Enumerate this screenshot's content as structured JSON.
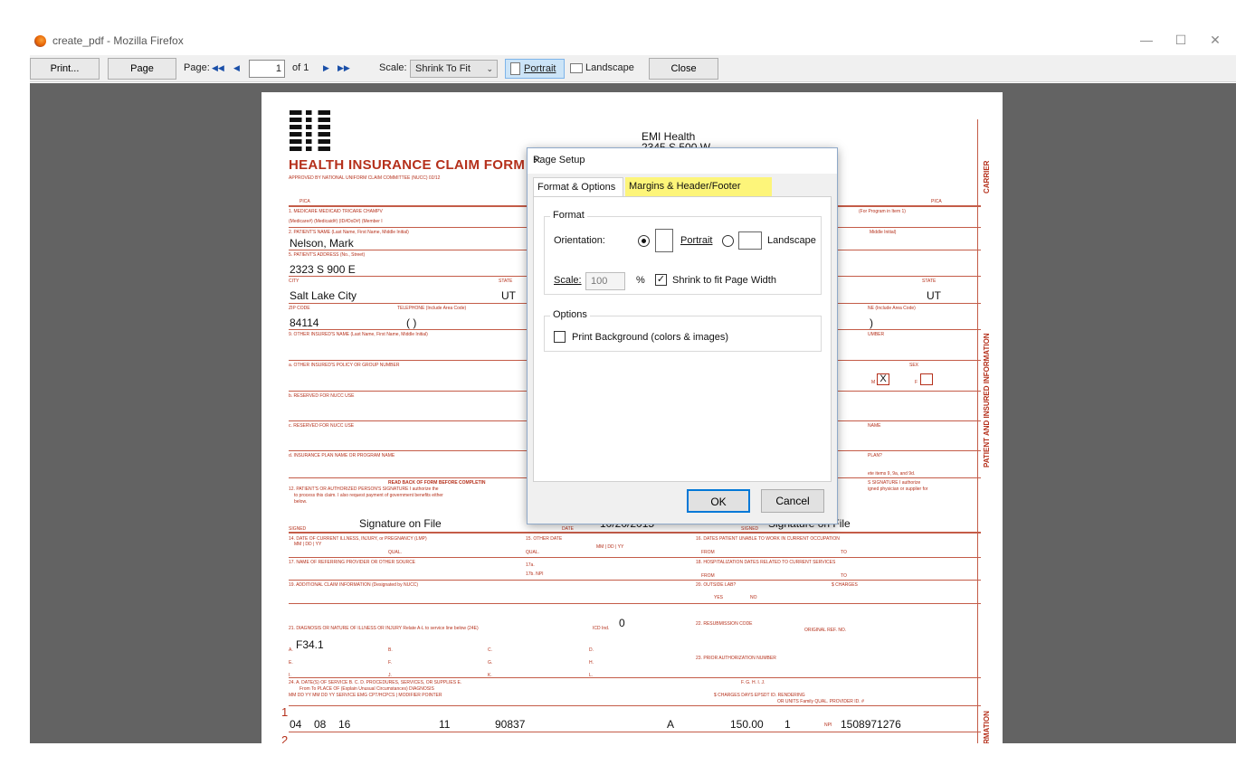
{
  "window": {
    "title": "create_pdf - Mozilla Firefox",
    "minimize": "—",
    "maximize": "☐",
    "close": "✕"
  },
  "toolbar": {
    "print": "Print...",
    "page_setup": "Page Setup...",
    "page_label": "Page:",
    "first_icon": "◀◀",
    "prev_icon": "◀",
    "page_value": "1",
    "of_text": "of  1",
    "next_icon": "▶",
    "last_icon": "▶▶",
    "scale_label": "Scale:",
    "scale_value": "Shrink To Fit",
    "portrait": "Portrait",
    "landscape": "Landscape",
    "close": "Close"
  },
  "form": {
    "payer_name": "EMI Health",
    "payer_addr": "2345 S 500 W",
    "title": "HEALTH INSURANCE CLAIM FORM",
    "subtitle": "APPROVED BY NATIONAL UNIFORM CLAIM COMMITTEE (NUCC) 02/12",
    "pica_left": "PICA",
    "pica_right": "PICA",
    "medicare_row": "1.  MEDICARE      MEDICAID        TRICARE           CHAMPV",
    "medicare_row2": "(Medicare#)       (Medicaid#)       (ID#DoD#)         (Member I",
    "program_note": "(For Program in Item 1)",
    "patient_name_lbl": "2. PATIENT'S NAME (Last Name, First Name, Middle Initial)",
    "patient_name": "Nelson, Mark",
    "middle_initial_lbl": "Middle Initial)",
    "address_lbl": "5. PATIENT'S ADDRESS (No., Street)",
    "address": "2323 S 900 E",
    "city_lbl": "CITY",
    "state_lbl": "STATE",
    "city": "Salt Lake City",
    "state": "UT",
    "state2_lbl": "STATE",
    "state2": "UT",
    "zip_lbl": "ZIP CODE",
    "phone_lbl": "TELEPHONE (Include Area Code)",
    "zip": "84114",
    "phone_paren": "(      )",
    "phone2_lbl": "NE (Include Area Code)",
    "phone2_paren": ")",
    "other_insured_lbl": "9. OTHER INSURED'S NAME (Last Name, First Name, Middle Initial)",
    "number_lbl": "UMBER",
    "other_policy_lbl": "a. OTHER INSURED'S POLICY OR GROUP NUMBER",
    "sex_lbl": "SEX",
    "m_lbl": "M",
    "m_mark": "X",
    "f_lbl": "F",
    "nucc_lbl_b": "b. RESERVED FOR NUCC USE",
    "nucc_lbl_c": "c. RESERVED FOR NUCC USE",
    "name_lbl": "NAME",
    "plan_lbl": "d. INSURANCE PLAN NAME OR PROGRAM NAME",
    "plan_q": "PLAN?",
    "items_note": "ete items 9, 9a, and 9d.",
    "read_back": "READ BACK OF FORM BEFORE COMPLETIN",
    "sig_text": "12. PATIENT'S OR AUTHORIZED PERSON'S SIGNATURE  I authorize the",
    "sig_text2": "to process this claim. I also request payment of government benefits either",
    "sig_text3": "below.",
    "insured_sig_note": "S SIGNATURE I authorize",
    "insured_sig_note2": "igned physician or supplier for",
    "signed_lbl": "SIGNED",
    "signature": "Signature on File",
    "date_lbl": "DATE",
    "date_value": "10/20/2015",
    "signed2_lbl": "SIGNED",
    "signature2": "Signature on File",
    "illness_lbl": "14. DATE OF CURRENT ILLNESS, INJURY, or PREGNANCY (LMP)",
    "mmddyy": "MM  |  DD  |  YY",
    "qual": "QUAL.",
    "other_date_lbl": "15. OTHER DATE",
    "qual2": "QUAL.",
    "mmddyy2": "MM  |  DD  |  YY",
    "unable_lbl": "16. DATES PATIENT UNABLE TO WORK IN CURRENT OCCUPATION",
    "from_lbl": "FROM",
    "to_lbl": "TO",
    "referring_lbl": "17. NAME OF REFERRING PROVIDER OR OTHER SOURCE",
    "ref_17a": "17a.",
    "ref_17b": "17b.  NPI",
    "hosp_lbl": "18. HOSPITALIZATION DATES RELATED TO CURRENT SERVICES",
    "from2_lbl": "FROM",
    "to2_lbl": "TO",
    "addl_lbl": "19. ADDITIONAL CLAIM INFORMATION (Designated by NUCC)",
    "outside_lab_lbl": "20. OUTSIDE LAB?",
    "charges_lbl": "$ CHARGES",
    "yes_lbl": "YES",
    "no_lbl": "NO",
    "diag_lbl": "21. DIAGNOSIS OR NATURE OF ILLNESS OR INJURY  Relate A-L to service line below (24E)",
    "icd_ind_lbl": "ICD Ind.",
    "icd_ind": "0",
    "resub_lbl": "22. RESUBMISSION CODE",
    "orig_ref_lbl": "ORIGINAL REF. NO.",
    "diag_a_lbl": "A.",
    "diag_a": "F34.1",
    "diag_b": "B.",
    "diag_c": "C.",
    "diag_d": "D.",
    "diag_e": "E.",
    "diag_f": "F.",
    "diag_g": "G.",
    "diag_h": "H.",
    "diag_i": "I.",
    "diag_j": "J.",
    "diag_k": "K.",
    "diag_l": "L.",
    "prior_auth_lbl": "23. PRIOR AUTHORIZATION NUMBER",
    "svc_hdr": "24. A.    DATE(S) OF SERVICE             B.      C.     D. PROCEDURES, SERVICES, OR SUPPLIES            E.",
    "svc_hdr2": "From                 To             PLACE OF           (Explain Unusual Circumstances)             DIAGNOSIS",
    "svc_hdr3": "MM   DD   YY   MM   DD   YY   SERVICE  EMG   CPT/HCPCS   |      MODIFIER               POINTER",
    "svc_hdr_r": "F.                     G.     H.     I.                J.",
    "svc_hdr_r2": "$ CHARGES          DAYS   EPSDT   ID.       RENDERING",
    "svc_hdr_r3": "OR UNITS   Family   QUAL.     PROVIDER ID. #",
    "row_num_1": "1",
    "row_num_2": "2",
    "line1": {
      "mm": "04",
      "dd": "08",
      "yy": "16",
      "pos": "11",
      "cpt": "90837",
      "pointer": "A",
      "charges": "150.00",
      "units": "1",
      "npi_lbl": "NPI",
      "npi": "1508971276"
    },
    "side_carrier": "CARRIER",
    "side_patient": "PATIENT AND INSURED INFORMATION",
    "side_info": "INFORMATION"
  },
  "dialog": {
    "title": "Page Setup",
    "close_icon": "✕",
    "tabs": [
      "Format & Options",
      "Margins & Header/Footer"
    ],
    "format_group": "Format",
    "orientation_label": "Orientation:",
    "portrait": "Portrait",
    "landscape": "Landscape",
    "scale_label": "Scale:",
    "scale_value": "100",
    "percent": "%",
    "shrink_label": "Shrink to fit Page Width",
    "shrink_checked": "✓",
    "options_group": "Options",
    "print_bg_label": "Print Background (colors & images)",
    "ok": "OK",
    "cancel": "Cancel",
    "highlight_color": "#fdf57a"
  }
}
